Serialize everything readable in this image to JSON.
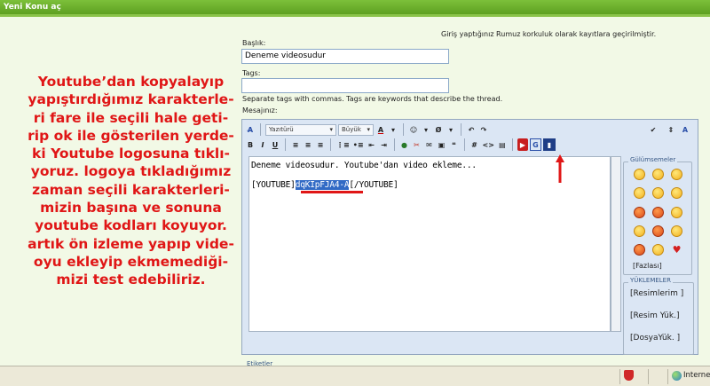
{
  "header": {
    "title": "Yeni Konu aç"
  },
  "notice": "Giriş yaptığınız Rumuz korkuluk olarak kayıtlara geçirilmiştir.",
  "annotation": {
    "lines": [
      "Youtube’dan kopyalayıp",
      "yapıştırdığımız karakterle-",
      "ri fare ile seçili hale geti-",
      "rip ok ile gösterilen yerde-",
      "ki Youtube logosuna tıklı-",
      "yoruz. logoya tıkladığımız",
      "zaman seçili karakterleri-",
      "mizin başına ve sonuna",
      "youtube kodları koyuyor.",
      "artık ön izleme yapıp vide-",
      "oyu ekleyip ekmemediği-",
      "mizi test edebiliriz."
    ],
    "color": "#e01616"
  },
  "form": {
    "title_label": "Başlık:",
    "title_value": "Deneme videosudur",
    "tags_label": "Tags:",
    "tags_value": "",
    "tags_help": "Separate tags with commas. Tags are keywords that describe the thread.",
    "message_label": "Mesajınız:"
  },
  "toolbar": {
    "font_combo": "Yazıtürü",
    "size_combo": "Büyük",
    "buttons_row2": [
      "B",
      "I",
      "U"
    ],
    "code_hash": "#",
    "code_html": "<>"
  },
  "editor": {
    "line1": "Deneme videosudur. Youtube'dan video ekleme...",
    "line2_before": "[YOUTUBE]",
    "line2_selected": "dqKIpFJA4-A",
    "line2_after": "[/YOUTUBE]"
  },
  "sidebar": {
    "smilies_legend": "Gülümsemeler",
    "more_link": "[Fazlası]",
    "uploads_legend": "YÜKLEMELER",
    "links": [
      "[Resimlerim ]",
      "[Resim Yük.]",
      "[DosyaYük. ]"
    ]
  },
  "bottom": {
    "etiket_label": "Etiketler"
  },
  "statusbar": {
    "zone": "Interne"
  },
  "icons": [
    "spell-check-icon",
    "youtube-icon",
    "google-icon",
    "arrow-up-icon",
    "globe-icon",
    "shield-icon"
  ]
}
